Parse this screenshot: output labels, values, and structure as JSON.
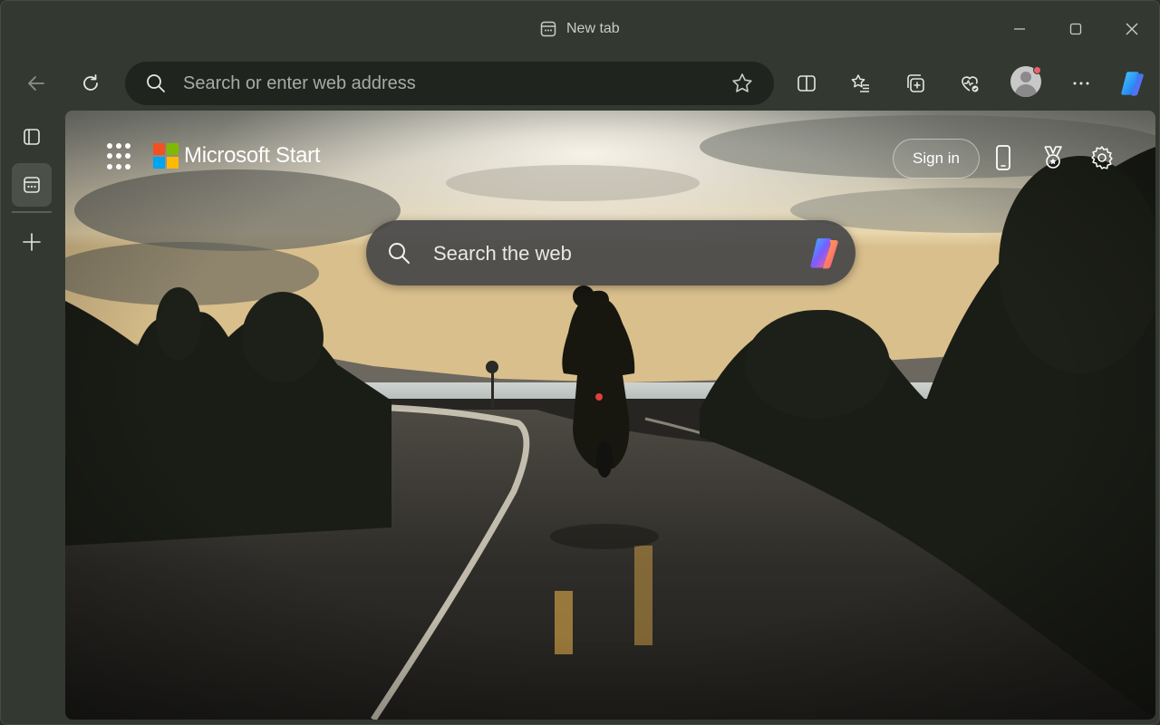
{
  "window": {
    "tab_title": "New tab",
    "controls": [
      "minimize",
      "maximize",
      "close"
    ]
  },
  "toolbar": {
    "address_placeholder": "Search or enter web address",
    "buttons": [
      "back-icon",
      "refresh-icon",
      "favorites-star-icon",
      "split-screen-icon",
      "favorites-icon",
      "collections-icon",
      "browser-essentials-icon",
      "profile-avatar",
      "more-icon",
      "copilot-icon"
    ]
  },
  "sidebar": {
    "items": [
      "tab-actions-icon",
      "new-tab-page-icon",
      "add-icon"
    ]
  },
  "new_tab_page": {
    "brand": "Microsoft Start",
    "sign_in": "Sign in",
    "search_placeholder": "Search the web",
    "header_icons": [
      "apps-grid-icon",
      "phone-icon",
      "rewards-icon",
      "settings-gear-icon"
    ],
    "background": "Motorcyclist riding on a winding road at sunset by a lake"
  },
  "colors": {
    "window_bg": "#333930",
    "address_bg": "#20241f",
    "ms_red": "#f25022",
    "ms_green": "#7fba00",
    "ms_blue": "#00a4ef",
    "ms_yellow": "#ffb900"
  }
}
